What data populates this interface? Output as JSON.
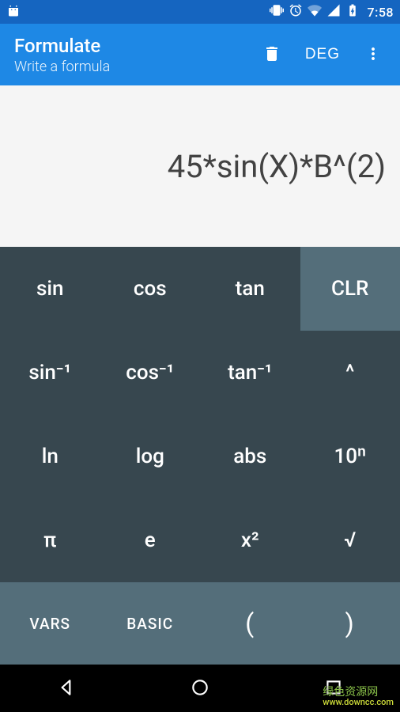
{
  "status": {
    "time": "7:58"
  },
  "appbar": {
    "title": "Formulate",
    "subtitle": "Write a formula",
    "angle_mode": "DEG"
  },
  "display": {
    "expression": "45*sin(X)*B^(2)"
  },
  "keys": {
    "r1c1": "sin",
    "r1c2": "cos",
    "r1c3": "tan",
    "r1c4": "CLR",
    "r2c1": "sin⁻¹",
    "r2c2": "cos⁻¹",
    "r2c3": "tan⁻¹",
    "r2c4": "^",
    "r3c1": "ln",
    "r3c2": "log",
    "r3c3": "abs",
    "r3c4": "10ⁿ",
    "r4c1": "π",
    "r4c2": "e",
    "r4c3": "x²",
    "r4c4": "√"
  },
  "bottom": {
    "vars": "VARS",
    "basic": "BASIC",
    "lparen": "(",
    "rparen": ")"
  },
  "watermark": {
    "line1": "绿色资源网",
    "line2": "www.downcc.com"
  }
}
